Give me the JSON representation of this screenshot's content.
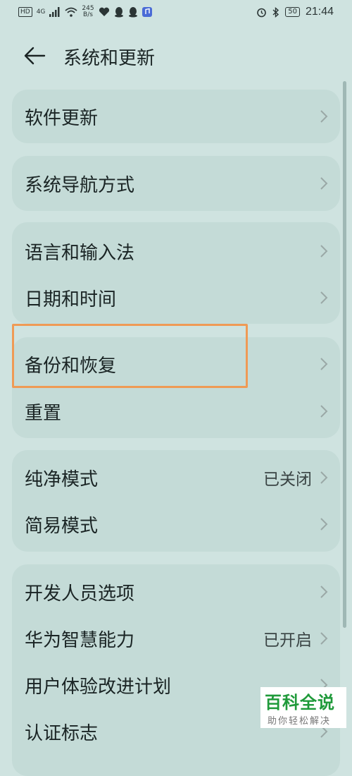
{
  "status_bar": {
    "hd": "HD",
    "network": "4G",
    "speed_value": "245",
    "speed_unit": "B/s",
    "battery": "50",
    "time": "21:44"
  },
  "header": {
    "title": "系统和更新"
  },
  "cards": [
    {
      "items": [
        {
          "label": "软件更新",
          "value": ""
        }
      ]
    },
    {
      "items": [
        {
          "label": "系统导航方式",
          "value": ""
        }
      ]
    },
    {
      "items": [
        {
          "label": "语言和输入法",
          "value": ""
        },
        {
          "label": "日期和时间",
          "value": ""
        }
      ]
    },
    {
      "items": [
        {
          "label": "备份和恢复",
          "value": ""
        },
        {
          "label": "重置",
          "value": ""
        }
      ]
    },
    {
      "items": [
        {
          "label": "纯净模式",
          "value": "已关闭"
        },
        {
          "label": "简易模式",
          "value": ""
        }
      ]
    },
    {
      "items": [
        {
          "label": "开发人员选项",
          "value": ""
        },
        {
          "label": "华为智慧能力",
          "value": "已开启"
        },
        {
          "label": "用户体验改进计划",
          "value": ""
        },
        {
          "label": "认证标志",
          "value": ""
        }
      ]
    }
  ],
  "watermark": {
    "title": "百科全说",
    "subtitle": "助你轻松解决"
  },
  "colors": {
    "background": "#cfe3e0",
    "card": "#c4dbd7",
    "highlight": "#ef9a55",
    "watermark_green": "#1f9a3a"
  }
}
